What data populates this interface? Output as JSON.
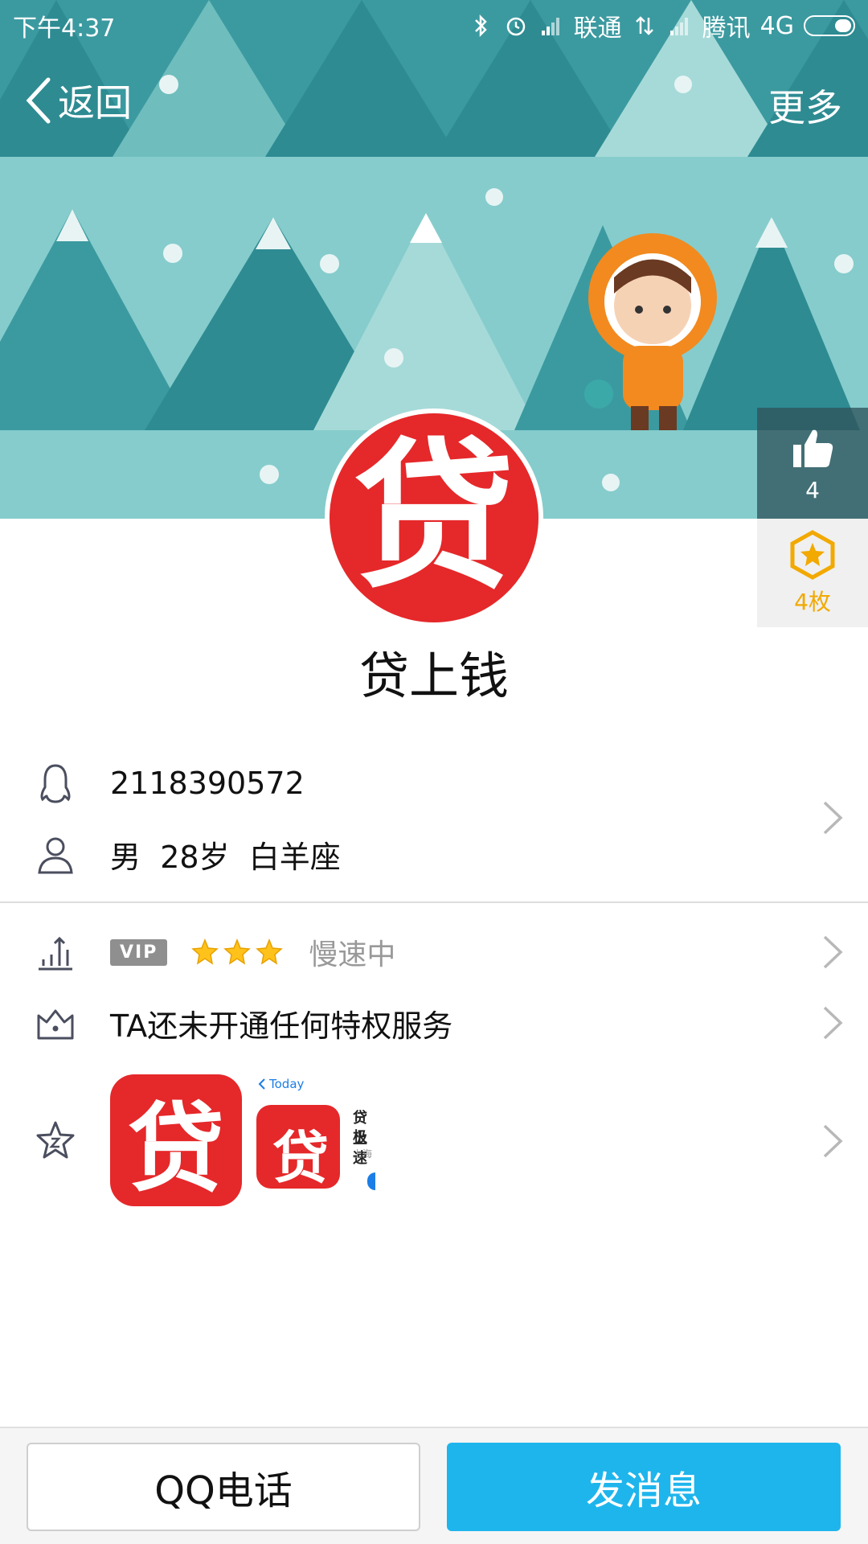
{
  "status_bar": {
    "time": "下午4:37",
    "carrier1": "联通",
    "carrier2": "腾讯",
    "network": "4G"
  },
  "nav": {
    "back_label": "返回",
    "more_label": "更多"
  },
  "side": {
    "like_count": "4",
    "medal_count": "4枚"
  },
  "profile": {
    "avatar_glyph": "贷",
    "name": "贷上钱"
  },
  "info": {
    "qq_number": "2118390572",
    "gender": "男",
    "age": "28岁",
    "zodiac": "白羊座"
  },
  "level": {
    "vip_label": "VIP",
    "star_count": 3,
    "speed_status": "慢速中"
  },
  "privilege": {
    "text": "TA还未开通任何特权服务"
  },
  "gallery": {
    "app_icon_glyph": "贷",
    "shot_today_label": "Today",
    "shot_title_line1": "贷上",
    "shot_title_line2": "极速",
    "shot_sub": "上海"
  },
  "actions": {
    "call_label": "QQ电话",
    "message_label": "发消息"
  },
  "colors": {
    "primary_blue": "#1eb5ec",
    "brand_red": "#e5282a",
    "medal_gold": "#f2a900",
    "cover_teal": "#86cccc"
  }
}
